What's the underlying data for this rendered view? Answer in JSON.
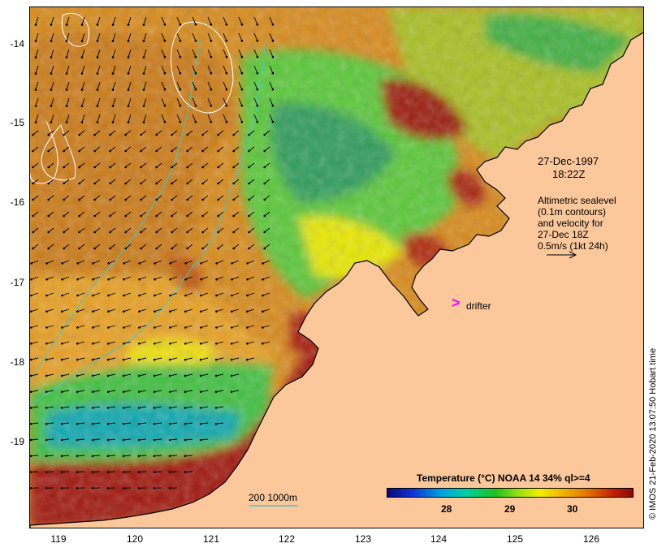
{
  "map": {
    "lat_ticks": [
      "-14",
      "-15",
      "-16",
      "-17",
      "-18",
      "-19"
    ],
    "lon_ticks": [
      "119",
      "120",
      "121",
      "122",
      "123",
      "124",
      "125",
      "126"
    ],
    "lon_range": [
      118.65,
      126.7
    ],
    "lat_range": [
      -13.6,
      -20.15
    ]
  },
  "annotations": {
    "date": "27-Dec-1997",
    "time": "18:22Z",
    "altimetry_line1": "Altimetric sealevel",
    "altimetry_line2": "(0.1m contours)",
    "altimetry_line3": "and velocity for",
    "altimetry_line4": "27-Dec 18Z",
    "altimetry_line5": "0.5m/s (1kt 24h)",
    "drifter_symbol": ">",
    "drifter_label": "drifter",
    "bathy_label": "200  1000m"
  },
  "legend": {
    "title": "Temperature (°C) NOAA 14 34% ql>=4",
    "ticks": [
      "28",
      "29",
      "30"
    ]
  },
  "credit": "© IMOS 21-Feb-2020 13:07:50 Hobart time",
  "colors": {
    "land": "#fbc79b",
    "warm": "#d97a10",
    "hot": "#9b1208",
    "cool_green": "#2ec22e",
    "yellow": "#e8e800",
    "drifter": "#ff00ff",
    "bathy": "#40c8c8"
  }
}
